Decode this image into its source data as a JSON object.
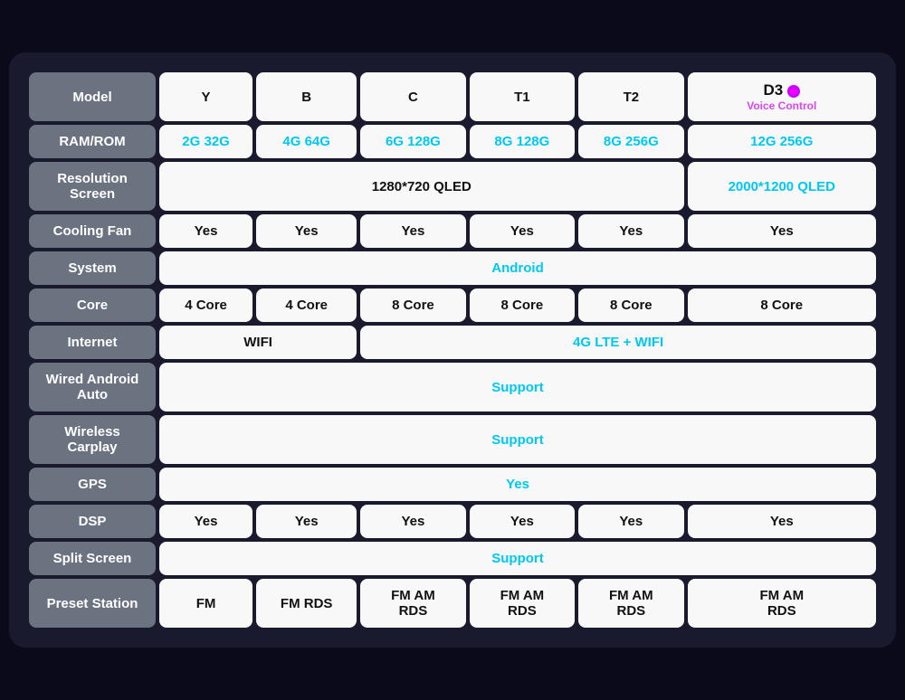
{
  "table": {
    "rows": [
      {
        "id": "model",
        "header": "Model",
        "cells": [
          {
            "text": "Y",
            "type": "white"
          },
          {
            "text": "B",
            "type": "white"
          },
          {
            "text": "C",
            "type": "white"
          },
          {
            "text": "T1",
            "type": "white"
          },
          {
            "text": "T2",
            "type": "white"
          },
          {
            "text": "D3",
            "type": "d3",
            "sub": "Voice Control"
          }
        ]
      },
      {
        "id": "ram",
        "header": "RAM/ROM",
        "cells": [
          {
            "text": "2G 32G",
            "type": "cyan"
          },
          {
            "text": "4G 64G",
            "type": "cyan"
          },
          {
            "text": "6G 128G",
            "type": "cyan"
          },
          {
            "text": "8G 128G",
            "type": "cyan"
          },
          {
            "text": "8G 256G",
            "type": "cyan"
          },
          {
            "text": "12G 256G",
            "type": "cyan"
          }
        ]
      },
      {
        "id": "resolution",
        "header": "Resolution\nScreen",
        "cells": [
          {
            "text": "1280*720 QLED",
            "type": "span-black",
            "span": 5
          },
          {
            "text": "2000*1200 QLED",
            "type": "span-cyan",
            "span": 1
          }
        ]
      },
      {
        "id": "cooling",
        "header": "Cooling Fan",
        "cells": [
          {
            "text": "Yes",
            "type": "white"
          },
          {
            "text": "Yes",
            "type": "white"
          },
          {
            "text": "Yes",
            "type": "white"
          },
          {
            "text": "Yes",
            "type": "white"
          },
          {
            "text": "Yes",
            "type": "white"
          },
          {
            "text": "Yes",
            "type": "white"
          }
        ]
      },
      {
        "id": "system",
        "header": "System",
        "cells": [
          {
            "text": "Android",
            "type": "span-cyan",
            "span": 6
          }
        ]
      },
      {
        "id": "core",
        "header": "Core",
        "cells": [
          {
            "text": "4 Core",
            "type": "white"
          },
          {
            "text": "4 Core",
            "type": "white"
          },
          {
            "text": "8 Core",
            "type": "white"
          },
          {
            "text": "8 Core",
            "type": "white"
          },
          {
            "text": "8 Core",
            "type": "white"
          },
          {
            "text": "8 Core",
            "type": "white"
          }
        ]
      },
      {
        "id": "internet",
        "header": "Internet",
        "cells": [
          {
            "text": "WIFI",
            "type": "span-black",
            "span": 2
          },
          {
            "text": "4G LTE + WIFI",
            "type": "span-cyan",
            "span": 4
          }
        ]
      },
      {
        "id": "wired-android",
        "header": "Wired Android\nAuto",
        "cells": [
          {
            "text": "Support",
            "type": "span-cyan",
            "span": 6
          }
        ]
      },
      {
        "id": "wireless-carplay",
        "header": "Wireless\nCarplay",
        "cells": [
          {
            "text": "Support",
            "type": "span-cyan",
            "span": 6
          }
        ]
      },
      {
        "id": "gps",
        "header": "GPS",
        "cells": [
          {
            "text": "Yes",
            "type": "span-cyan",
            "span": 6
          }
        ]
      },
      {
        "id": "dsp",
        "header": "DSP",
        "cells": [
          {
            "text": "Yes",
            "type": "white"
          },
          {
            "text": "Yes",
            "type": "white"
          },
          {
            "text": "Yes",
            "type": "white"
          },
          {
            "text": "Yes",
            "type": "white"
          },
          {
            "text": "Yes",
            "type": "white"
          },
          {
            "text": "Yes",
            "type": "white"
          }
        ]
      },
      {
        "id": "split-screen",
        "header": "Split Screen",
        "cells": [
          {
            "text": "Support",
            "type": "span-cyan",
            "span": 6
          }
        ]
      },
      {
        "id": "preset-station",
        "header": "Preset Station",
        "cells": [
          {
            "text": "FM",
            "type": "white"
          },
          {
            "text": "FM RDS",
            "type": "white"
          },
          {
            "text": "FM AM\nRDS",
            "type": "white"
          },
          {
            "text": "FM AM\nRDS",
            "type": "white"
          },
          {
            "text": "FM AM\nRDS",
            "type": "white"
          },
          {
            "text": "FM AM\nRDS",
            "type": "white"
          }
        ]
      }
    ]
  }
}
